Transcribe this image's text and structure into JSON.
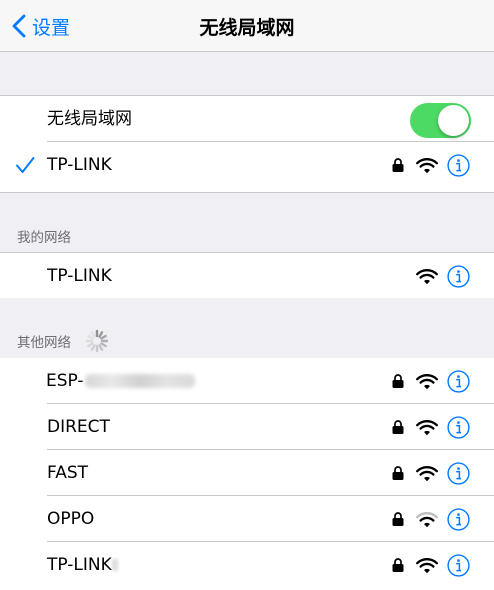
{
  "nav": {
    "back_label": "设置",
    "title": "无线局域网"
  },
  "wlan_toggle": {
    "label": "无线局域网",
    "on": true
  },
  "connected": {
    "name": "TP-LINK"
  },
  "my_networks": {
    "header": "我的网络",
    "items": [
      {
        "name": "TP-LINK"
      }
    ]
  },
  "other_networks": {
    "header": "其他网络",
    "items": [
      {
        "name": "ESP-"
      },
      {
        "name": "DIRECT"
      },
      {
        "name": "FAST"
      },
      {
        "name": "OPPO"
      },
      {
        "name": "TP-LINK"
      }
    ]
  },
  "colors": {
    "accent": "#007aff",
    "toggle_on": "#4cd964"
  }
}
